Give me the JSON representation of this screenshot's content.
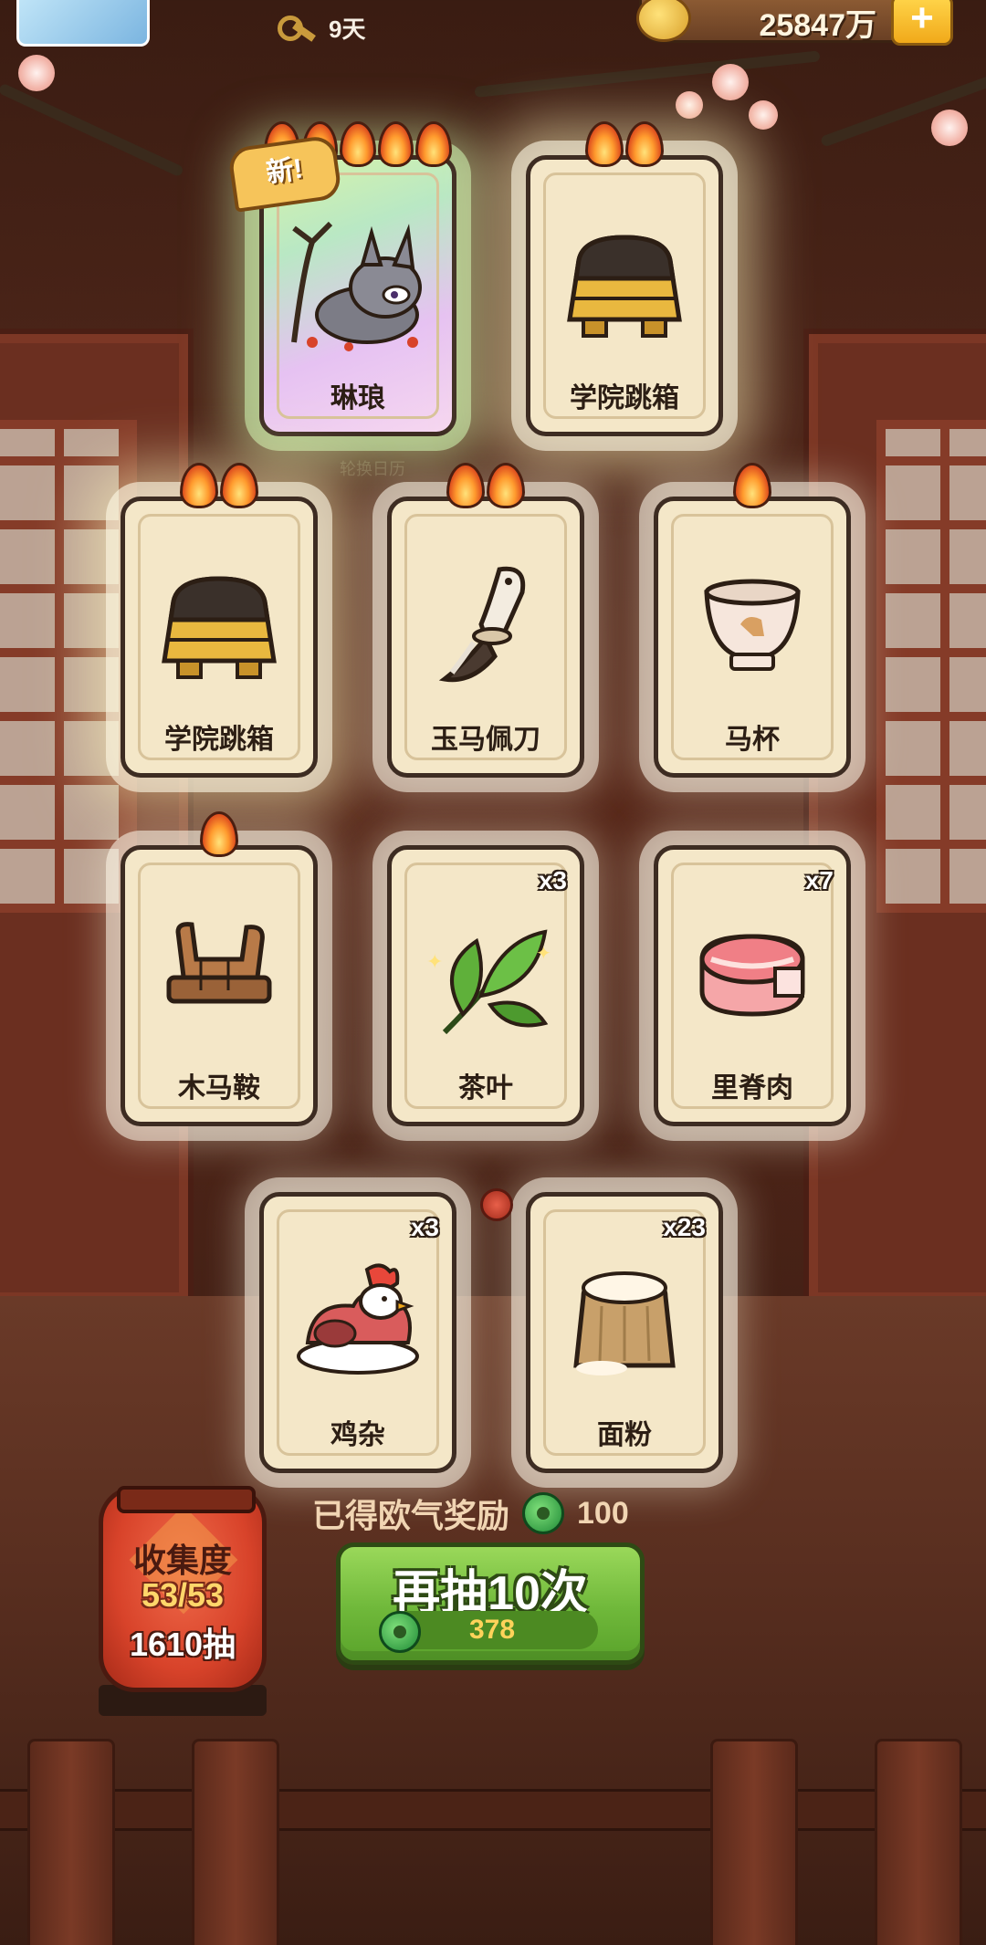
{
  "top_bar": {
    "day_text": "9天",
    "coins": "25847万",
    "add_label": "+"
  },
  "calendar_label": "轮换日历",
  "cards": [
    {
      "name": "琳琅",
      "flames": 5,
      "count": "",
      "is_new": true,
      "new_label": "新!",
      "art": "wolf-character-icon"
    },
    {
      "name": "学院跳箱",
      "flames": 2,
      "count": "",
      "art": "vaulting-box-icon"
    },
    {
      "name": "学院跳箱",
      "flames": 2,
      "count": "",
      "art": "vaulting-box-icon"
    },
    {
      "name": "玉马佩刀",
      "flames": 2,
      "count": "",
      "art": "jade-horse-knife-icon"
    },
    {
      "name": "马杯",
      "flames": 1,
      "count": "",
      "art": "horse-cup-icon"
    },
    {
      "name": "木马鞍",
      "flames": 1,
      "count": "",
      "art": "wooden-saddle-icon"
    },
    {
      "name": "茶叶",
      "flames": 0,
      "count": "x3",
      "art": "tea-leaf-icon"
    },
    {
      "name": "里脊肉",
      "flames": 0,
      "count": "x7",
      "art": "tenderloin-meat-icon"
    },
    {
      "name": "鸡杂",
      "flames": 0,
      "count": "x3",
      "art": "chicken-giblets-icon"
    },
    {
      "name": "面粉",
      "flames": 0,
      "count": "x23",
      "art": "flour-sack-icon"
    }
  ],
  "reward": {
    "label": "已得欧气奖励",
    "value": "100"
  },
  "draw_button": {
    "title": "再抽10次",
    "cost": "378"
  },
  "collection": {
    "title": "收集度",
    "progress": "53/53",
    "draws": "1610抽"
  },
  "colors": {
    "draw_button_green": "#6fb83a",
    "lantern_red": "#d8432a",
    "card_bg": "#f4e7c8",
    "flame_orange": "#ff9b2e"
  }
}
